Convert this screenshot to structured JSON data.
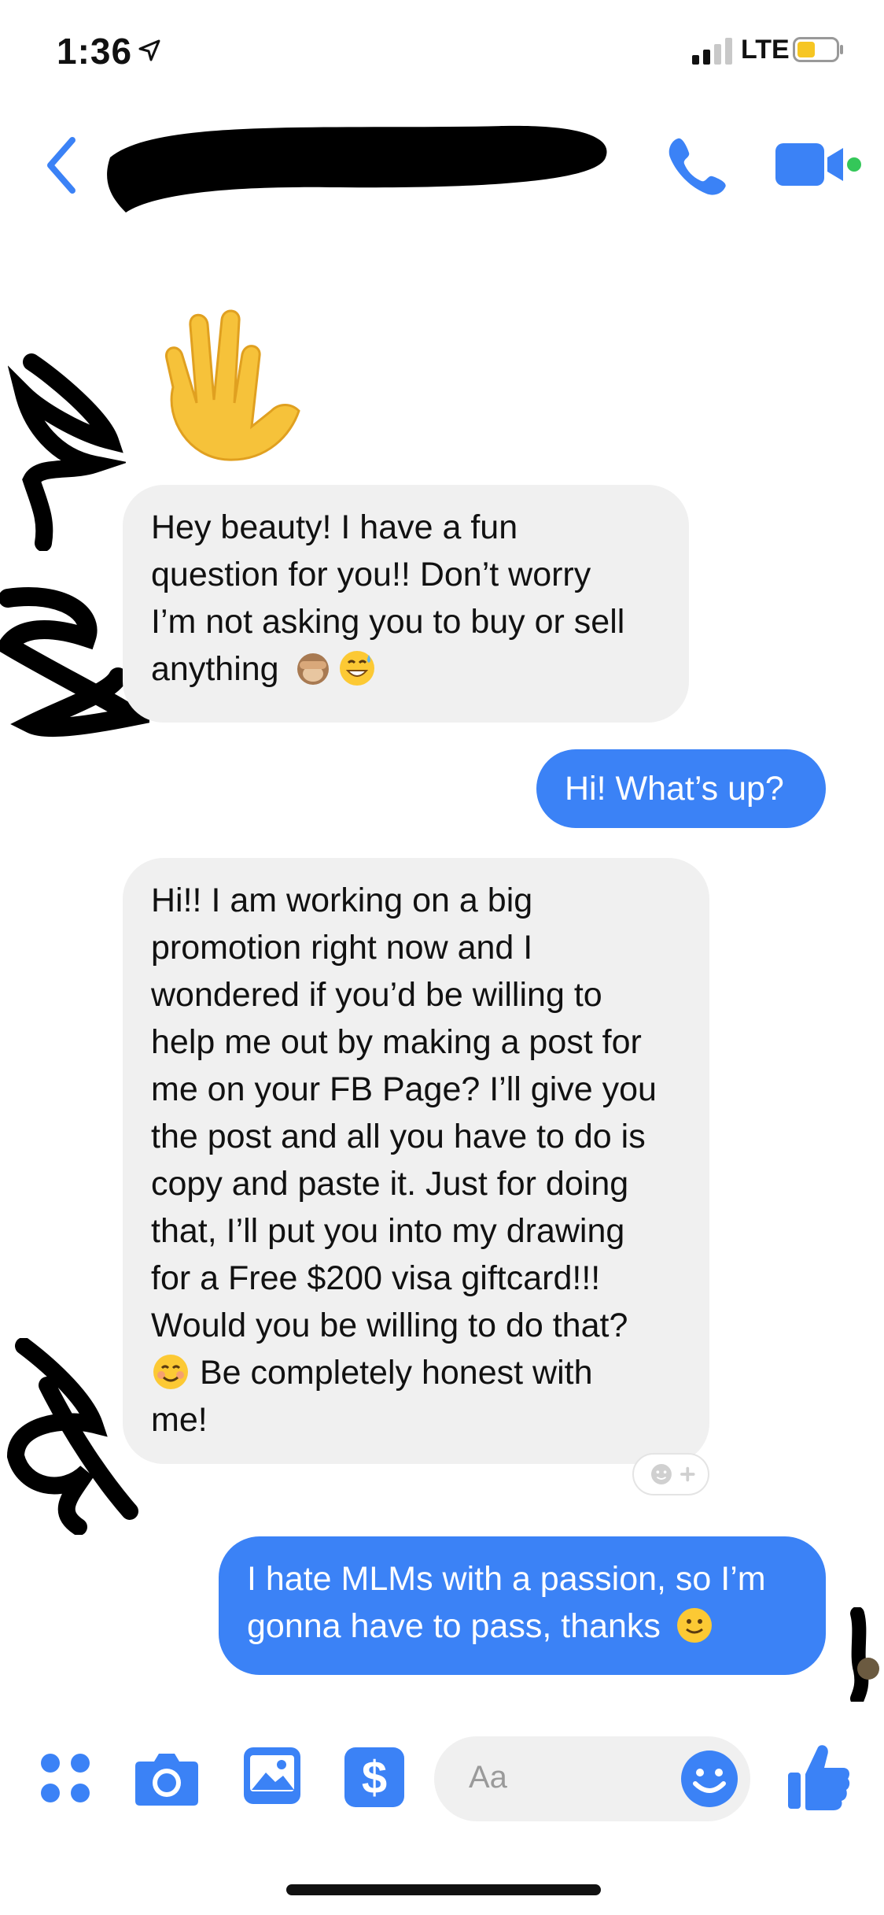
{
  "status_bar": {
    "time": "1:36",
    "carrier": "LTE",
    "icons": [
      "location-arrow-icon",
      "signal-icon",
      "battery-icon"
    ]
  },
  "header": {
    "icons": [
      "chevron-left-icon",
      "phone-icon",
      "video-camera-icon"
    ],
    "accent": "#3b82f6",
    "online_dot": "#34c759"
  },
  "messages": [
    {
      "side": "incoming",
      "text": "Hey beauty! I have a fun\nquestion for you!! Don’t worry\nI’m not asking you to buy or sell\nanything",
      "emoji": [
        "monkey-see-no-evil-icon",
        "grinning-sweat-icon"
      ]
    },
    {
      "side": "outgoing",
      "text": "Hi! What’s up?"
    },
    {
      "side": "incoming",
      "text": "Hi!! I am working on a big\npromotion right now and I\nwondered if you’d be willing to\nhelp me out by making a post for\nme on your FB Page? I’ll give you\nthe post and all you have to do is\ncopy and paste it. Just for doing\nthat, I’ll put you into my drawing\nfor a Free $200 visa giftcard!!!\nWould you be willing to do that?",
      "text_after_emoji": " Be completely honest with\nme!",
      "emoji": [
        "smiling-blush-icon"
      ]
    },
    {
      "side": "outgoing",
      "text": "I hate MLMs with a passion, so I’m\ngonna have to pass, thanks",
      "emoji": [
        "slight-smile-icon"
      ]
    }
  ],
  "composer": {
    "placeholder": "Aa",
    "icons": [
      "apps-grid-icon",
      "camera-icon",
      "image-icon",
      "dollar-payment-icon",
      "emoji-smile-icon",
      "thumbs-up-icon"
    ]
  },
  "colors": {
    "outgoing_bubble": "#3b82f6",
    "incoming_bubble": "#f0f0f0",
    "icon_blue": "#3b82f6"
  }
}
